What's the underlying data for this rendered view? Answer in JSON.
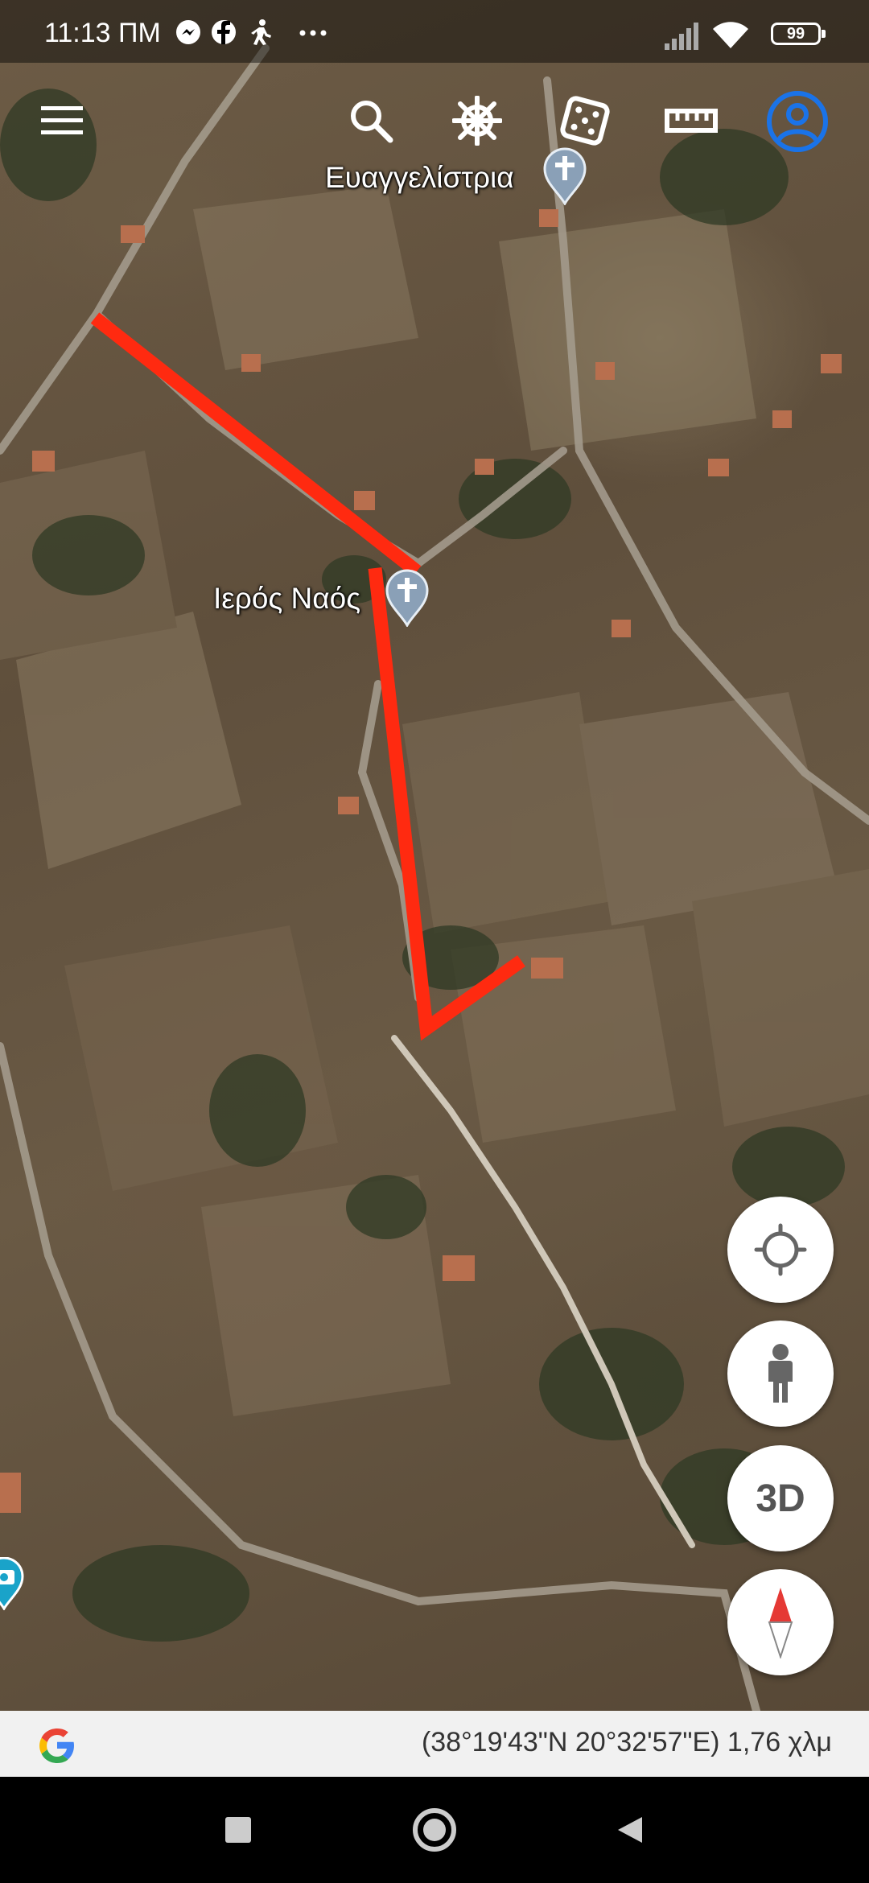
{
  "status_bar": {
    "time": "11:13 ΠΜ",
    "notification_icons": [
      "messenger-icon",
      "facebook-icon",
      "walking-icon",
      "more-dots-icon"
    ],
    "battery": "99"
  },
  "toolbar": {
    "icons": [
      "menu-icon",
      "search-icon",
      "voyager-wheel-icon",
      "dice-icon",
      "ruler-icon",
      "account-icon"
    ]
  },
  "map": {
    "labels": {
      "place_1": "Ευαγγελίστρια",
      "place_2": "Ιερός Ναός"
    },
    "measure_line_color": "#ff2a10"
  },
  "fabs": {
    "three_d_label": "3D",
    "icons": [
      "my-location-icon",
      "street-view-person-icon",
      "compass-icon"
    ]
  },
  "info_bar": {
    "coords_text": "(38°19'43\"N 20°32'57\"E) 1,76 χλμ"
  },
  "colors": {
    "accent_blue": "#1a73e8",
    "measure_red": "#ff2a10"
  }
}
